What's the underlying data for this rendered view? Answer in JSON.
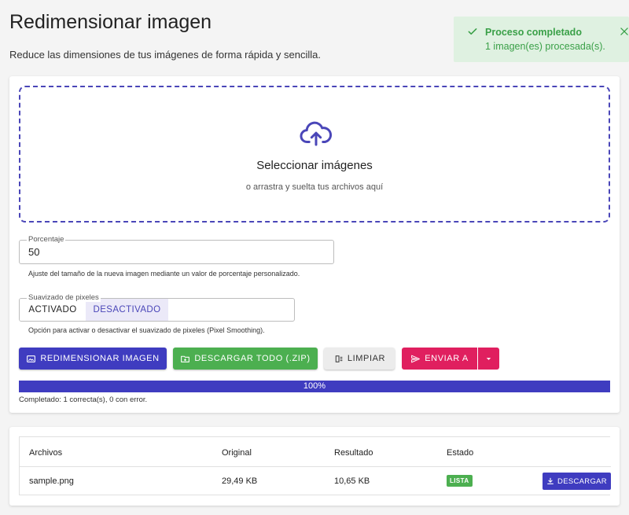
{
  "header": {
    "title": "Redimensionar imagen",
    "subtitle": "Reduce las dimensiones de tus imágenes de forma rápida y sencilla."
  },
  "toast": {
    "title": "Proceso completado",
    "message": "1 imagen(es) procesada(s).",
    "color": "#3aa048",
    "icons": [
      "check-icon",
      "close-icon"
    ]
  },
  "dropzone": {
    "title": "Seleccionar imágenes",
    "subtitle": "o arrastra y suelta tus archivos aquí",
    "icon": "cloud-upload-icon"
  },
  "percentage": {
    "label": "Porcentaje",
    "value": "50",
    "help": "Ajuste del tamaño de la nueva imagen mediante un valor de porcentaje personalizado."
  },
  "smoothing": {
    "label": "Suavizado de pixeles",
    "on_label": "ACTIVADO",
    "off_label": "DESACTIVADO",
    "selected": "DESACTIVADO",
    "help": "Opción para activar o desactivar el suavizado de pixeles (Pixel Smoothing)."
  },
  "actions": {
    "resize_label": "REDIMENSIONAR IMAGEN",
    "zip_label": "DESCARGAR TODO (.ZIP)",
    "clear_label": "LIMPIAR",
    "send_label": "ENVIAR A"
  },
  "progress": {
    "value": 100,
    "text": "100%",
    "status": "Completado: 1 correcta(s), 0 con error."
  },
  "files": {
    "columns": [
      "Archivos",
      "Original",
      "Resultado",
      "Estado"
    ],
    "rows": [
      {
        "name": "sample.png",
        "original": "29,49 KB",
        "result": "10,65 KB",
        "status": "LISTA",
        "download_label": "DESCARGAR"
      }
    ]
  },
  "colors": {
    "primary": "#3f3cc0",
    "success": "#4caf50",
    "danger": "#e01f5f"
  }
}
